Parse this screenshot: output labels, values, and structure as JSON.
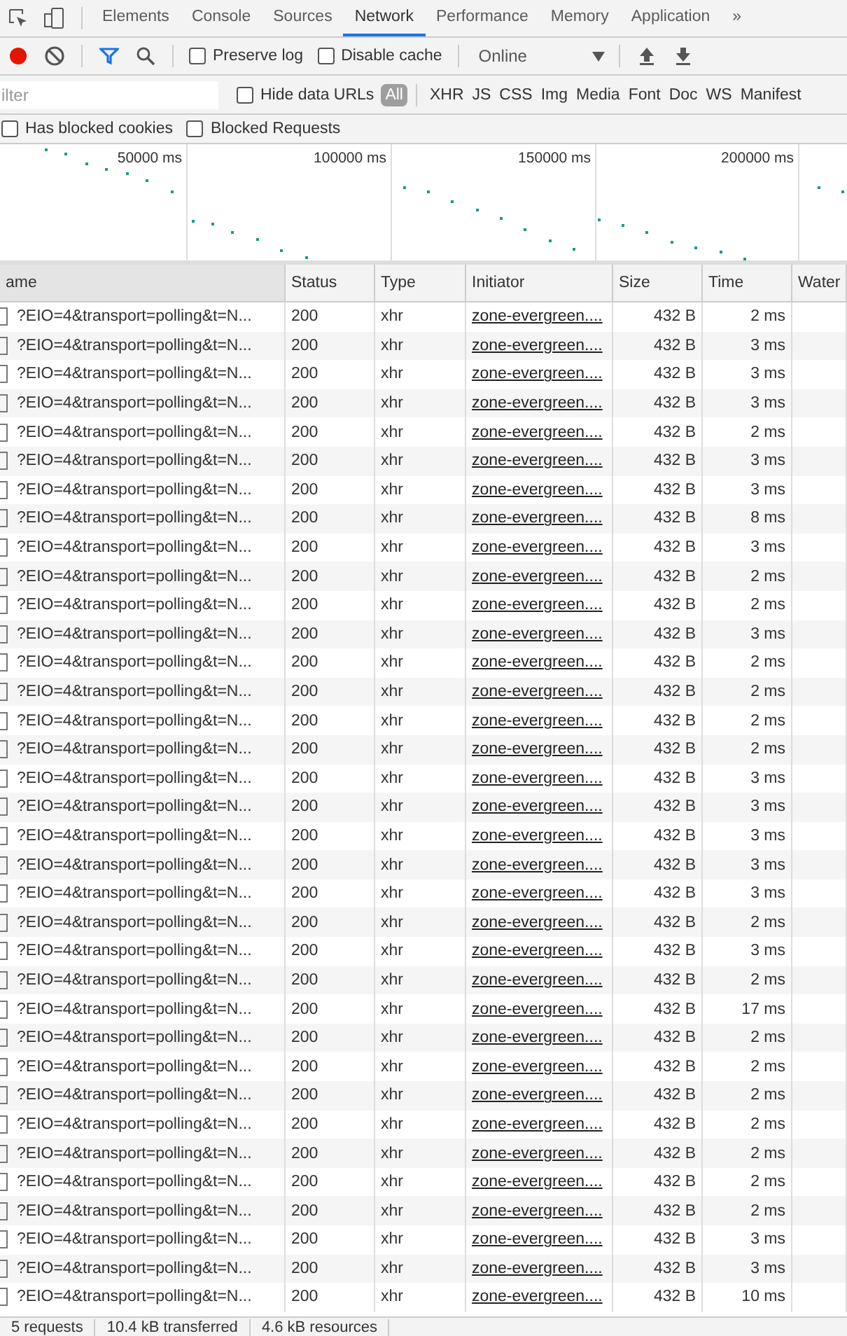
{
  "panel_tabs": [
    {
      "label": "Elements",
      "selected": false
    },
    {
      "label": "Console",
      "selected": false
    },
    {
      "label": "Sources",
      "selected": false
    },
    {
      "label": "Network",
      "selected": true
    },
    {
      "label": "Performance",
      "selected": false
    },
    {
      "label": "Memory",
      "selected": false
    },
    {
      "label": "Application",
      "selected": false
    }
  ],
  "more_tabs": "»",
  "toolbar": {
    "recording": true,
    "filter_active": true,
    "preserve_log": {
      "label": "Preserve log",
      "checked": false
    },
    "disable_cache": {
      "label": "Disable cache",
      "checked": false
    },
    "throttling": "Online"
  },
  "filter_bar": {
    "placeholder": "ilter",
    "hide_data_urls": {
      "label": "Hide data URLs",
      "checked": false
    },
    "types": [
      {
        "label": "All",
        "selected": true
      },
      {
        "label": "XHR",
        "selected": false
      },
      {
        "label": "JS",
        "selected": false
      },
      {
        "label": "CSS",
        "selected": false
      },
      {
        "label": "Img",
        "selected": false
      },
      {
        "label": "Media",
        "selected": false
      },
      {
        "label": "Font",
        "selected": false
      },
      {
        "label": "Doc",
        "selected": false
      },
      {
        "label": "WS",
        "selected": false
      },
      {
        "label": "Manifest",
        "selected": false
      }
    ]
  },
  "options": [
    {
      "label": "Has blocked cookies",
      "checked": false
    },
    {
      "label": "Blocked Requests",
      "checked": false
    }
  ],
  "overview": {
    "ticks": [
      "50000 ms",
      "100000 ms",
      "150000 ms",
      "200000 ms"
    ]
  },
  "table": {
    "columns": [
      "ame",
      "Status",
      "Type",
      "Initiator",
      "Size",
      "Time",
      "Water"
    ],
    "rows": [
      [
        "?EIO=4&transport=polling&t=N...",
        "200",
        "xhr",
        "zone-evergreen....",
        "432 B",
        "2 ms"
      ],
      [
        "?EIO=4&transport=polling&t=N...",
        "200",
        "xhr",
        "zone-evergreen....",
        "432 B",
        "3 ms"
      ],
      [
        "?EIO=4&transport=polling&t=N...",
        "200",
        "xhr",
        "zone-evergreen....",
        "432 B",
        "3 ms"
      ],
      [
        "?EIO=4&transport=polling&t=N...",
        "200",
        "xhr",
        "zone-evergreen....",
        "432 B",
        "3 ms"
      ],
      [
        "?EIO=4&transport=polling&t=N...",
        "200",
        "xhr",
        "zone-evergreen....",
        "432 B",
        "2 ms"
      ],
      [
        "?EIO=4&transport=polling&t=N...",
        "200",
        "xhr",
        "zone-evergreen....",
        "432 B",
        "3 ms"
      ],
      [
        "?EIO=4&transport=polling&t=N...",
        "200",
        "xhr",
        "zone-evergreen....",
        "432 B",
        "3 ms"
      ],
      [
        "?EIO=4&transport=polling&t=N...",
        "200",
        "xhr",
        "zone-evergreen....",
        "432 B",
        "8 ms"
      ],
      [
        "?EIO=4&transport=polling&t=N...",
        "200",
        "xhr",
        "zone-evergreen....",
        "432 B",
        "3 ms"
      ],
      [
        "?EIO=4&transport=polling&t=N...",
        "200",
        "xhr",
        "zone-evergreen....",
        "432 B",
        "2 ms"
      ],
      [
        "?EIO=4&transport=polling&t=N...",
        "200",
        "xhr",
        "zone-evergreen....",
        "432 B",
        "2 ms"
      ],
      [
        "?EIO=4&transport=polling&t=N...",
        "200",
        "xhr",
        "zone-evergreen....",
        "432 B",
        "3 ms"
      ],
      [
        "?EIO=4&transport=polling&t=N...",
        "200",
        "xhr",
        "zone-evergreen....",
        "432 B",
        "2 ms"
      ],
      [
        "?EIO=4&transport=polling&t=N...",
        "200",
        "xhr",
        "zone-evergreen....",
        "432 B",
        "2 ms"
      ],
      [
        "?EIO=4&transport=polling&t=N...",
        "200",
        "xhr",
        "zone-evergreen....",
        "432 B",
        "2 ms"
      ],
      [
        "?EIO=4&transport=polling&t=N...",
        "200",
        "xhr",
        "zone-evergreen....",
        "432 B",
        "2 ms"
      ],
      [
        "?EIO=4&transport=polling&t=N...",
        "200",
        "xhr",
        "zone-evergreen....",
        "432 B",
        "3 ms"
      ],
      [
        "?EIO=4&transport=polling&t=N...",
        "200",
        "xhr",
        "zone-evergreen....",
        "432 B",
        "3 ms"
      ],
      [
        "?EIO=4&transport=polling&t=N...",
        "200",
        "xhr",
        "zone-evergreen....",
        "432 B",
        "3 ms"
      ],
      [
        "?EIO=4&transport=polling&t=N...",
        "200",
        "xhr",
        "zone-evergreen....",
        "432 B",
        "3 ms"
      ],
      [
        "?EIO=4&transport=polling&t=N...",
        "200",
        "xhr",
        "zone-evergreen....",
        "432 B",
        "3 ms"
      ],
      [
        "?EIO=4&transport=polling&t=N...",
        "200",
        "xhr",
        "zone-evergreen....",
        "432 B",
        "2 ms"
      ],
      [
        "?EIO=4&transport=polling&t=N...",
        "200",
        "xhr",
        "zone-evergreen....",
        "432 B",
        "3 ms"
      ],
      [
        "?EIO=4&transport=polling&t=N...",
        "200",
        "xhr",
        "zone-evergreen....",
        "432 B",
        "2 ms"
      ],
      [
        "?EIO=4&transport=polling&t=N...",
        "200",
        "xhr",
        "zone-evergreen....",
        "432 B",
        "17 ms"
      ],
      [
        "?EIO=4&transport=polling&t=N...",
        "200",
        "xhr",
        "zone-evergreen....",
        "432 B",
        "2 ms"
      ],
      [
        "?EIO=4&transport=polling&t=N...",
        "200",
        "xhr",
        "zone-evergreen....",
        "432 B",
        "2 ms"
      ],
      [
        "?EIO=4&transport=polling&t=N...",
        "200",
        "xhr",
        "zone-evergreen....",
        "432 B",
        "2 ms"
      ],
      [
        "?EIO=4&transport=polling&t=N...",
        "200",
        "xhr",
        "zone-evergreen....",
        "432 B",
        "2 ms"
      ],
      [
        "?EIO=4&transport=polling&t=N...",
        "200",
        "xhr",
        "zone-evergreen....",
        "432 B",
        "2 ms"
      ],
      [
        "?EIO=4&transport=polling&t=N...",
        "200",
        "xhr",
        "zone-evergreen....",
        "432 B",
        "2 ms"
      ],
      [
        "?EIO=4&transport=polling&t=N...",
        "200",
        "xhr",
        "zone-evergreen....",
        "432 B",
        "2 ms"
      ],
      [
        "?EIO=4&transport=polling&t=N...",
        "200",
        "xhr",
        "zone-evergreen....",
        "432 B",
        "3 ms"
      ],
      [
        "?EIO=4&transport=polling&t=N...",
        "200",
        "xhr",
        "zone-evergreen....",
        "432 B",
        "3 ms"
      ],
      [
        "?EIO=4&transport=polling&t=N...",
        "200",
        "xhr",
        "zone-evergreen....",
        "432 B",
        "10 ms"
      ]
    ]
  },
  "status_bar": [
    "5 requests",
    "10.4 kB transferred",
    "4.6 kB resources"
  ]
}
